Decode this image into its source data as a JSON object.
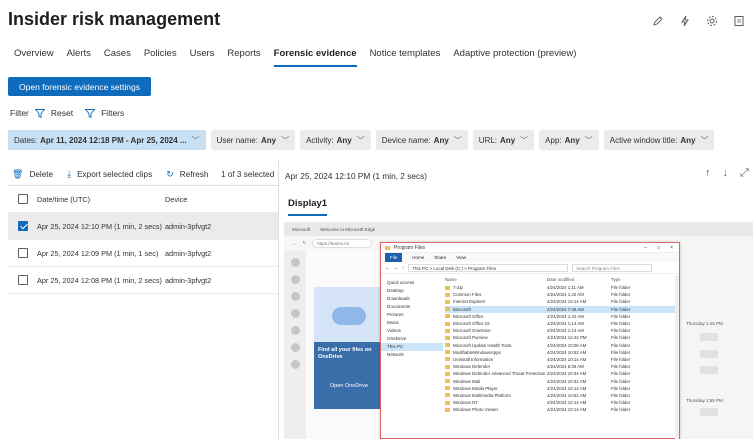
{
  "page": {
    "title": "Insider risk management"
  },
  "top_icons": [
    "edit-icon",
    "flash-icon",
    "settings-icon",
    "notepad-icon"
  ],
  "tabs": [
    {
      "label": "Overview",
      "active": false
    },
    {
      "label": "Alerts",
      "active": false
    },
    {
      "label": "Cases",
      "active": false
    },
    {
      "label": "Policies",
      "active": false
    },
    {
      "label": "Users",
      "active": false
    },
    {
      "label": "Reports",
      "active": false
    },
    {
      "label": "Forensic evidence",
      "active": true
    },
    {
      "label": "Notice templates",
      "active": false
    },
    {
      "label": "Adaptive protection (preview)",
      "active": false
    }
  ],
  "primary_button": "Open forensic evidence settings",
  "filter": {
    "label": "Filter",
    "reset": "Reset",
    "filters": "Filters"
  },
  "chips": [
    {
      "label": "Dates:",
      "value": "Apr 11, 2024 12:18 PM - Apr 25, 2024 ...",
      "selected": true
    },
    {
      "label": "User name:",
      "value": "Any",
      "selected": false
    },
    {
      "label": "Activity:",
      "value": "Any",
      "selected": false
    },
    {
      "label": "Device name:",
      "value": "Any",
      "selected": false
    },
    {
      "label": "URL:",
      "value": "Any",
      "selected": false
    },
    {
      "label": "App:",
      "value": "Any",
      "selected": false
    },
    {
      "label": "Active window title:",
      "value": "Any",
      "selected": false
    }
  ],
  "toolbar": {
    "delete": "Delete",
    "export": "Export selected clips",
    "refresh": "Refresh",
    "selection": "1 of 3 selected"
  },
  "table": {
    "headers": {
      "date": "Date/time (UTC)",
      "device": "Device"
    },
    "rows": [
      {
        "date": "Apr 25, 2024 12:10 PM (1 min, 2 secs)",
        "device": "admin-3pfvgt2",
        "checked": true
      },
      {
        "date": "Apr 25, 2024 12:09 PM (1 min, 1 sec)",
        "device": "admin-3pfvgt2",
        "checked": false
      },
      {
        "date": "Apr 25, 2024 12:08 PM (1 min, 2 secs)",
        "device": "admin-3pfvgt2",
        "checked": false
      }
    ]
  },
  "detail": {
    "title": "Apr 25, 2024 12:10 PM (1 min, 2 secs)",
    "display_tab": "Display1"
  },
  "recording": {
    "browser_tabs": [
      "Microsoft",
      "Welcome to Microsoft Edge"
    ],
    "browser_url": "https://teams.mi",
    "promo_text": "Find all your files on OneDrive",
    "promo_button": "Open OneDrive",
    "explorer": {
      "title": "Program Files",
      "ribbon": [
        "File",
        "Home",
        "Share",
        "View"
      ],
      "path": "This PC > Local Disk (C:) > Program Files",
      "search": "Search Program Files",
      "nav": [
        {
          "label": "Quick access",
          "hl": false
        },
        {
          "label": "Desktop",
          "hl": false
        },
        {
          "label": "Downloads",
          "hl": false
        },
        {
          "label": "Documents",
          "hl": false
        },
        {
          "label": "Pictures",
          "hl": false
        },
        {
          "label": "Music",
          "hl": false
        },
        {
          "label": "Videos",
          "hl": false
        },
        {
          "label": "OneDrive",
          "hl": false
        },
        {
          "label": "This PC",
          "hl": true
        },
        {
          "label": "Network",
          "hl": false
        }
      ],
      "columns": {
        "name": "Name",
        "date": "Date modified",
        "type": "Type"
      },
      "files": [
        {
          "name": "7-Zip",
          "date": "4/24/2024 1:11 AM",
          "type": "File folder",
          "hl": false
        },
        {
          "name": "Common Files",
          "date": "4/24/2024 1:42 AM",
          "type": "File folder",
          "hl": false
        },
        {
          "name": "Internet Explorer",
          "date": "4/24/2024 10:14 AM",
          "type": "File folder",
          "hl": false
        },
        {
          "name": "Microsoft",
          "date": "4/24/2024 7:49 AM",
          "type": "File folder",
          "hl": true
        },
        {
          "name": "Microsoft Office",
          "date": "4/24/2024 1:42 AM",
          "type": "File folder",
          "hl": false
        },
        {
          "name": "Microsoft Office 15",
          "date": "4/24/2024 1:14 AM",
          "type": "File folder",
          "hl": false
        },
        {
          "name": "Microsoft OneDrive",
          "date": "4/24/2024 1:14 AM",
          "type": "File folder",
          "hl": false
        },
        {
          "name": "Microsoft Purview",
          "date": "4/24/2024 12:42 PM",
          "type": "File folder",
          "hl": false
        },
        {
          "name": "Microsoft Update Health Tools",
          "date": "4/24/2024 10:06 AM",
          "type": "File folder",
          "hl": false
        },
        {
          "name": "ModifiableWindowsApps",
          "date": "4/24/2024 10:52 AM",
          "type": "File folder",
          "hl": false
        },
        {
          "name": "Uninstall Information",
          "date": "4/24/2024 10:14 AM",
          "type": "File folder",
          "hl": false
        },
        {
          "name": "Windows Defender",
          "date": "4/24/2024 6:39 AM",
          "type": "File folder",
          "hl": false
        },
        {
          "name": "Windows Defender Advanced Threat Protection",
          "date": "4/24/2024 10:34 AM",
          "type": "File folder",
          "hl": false
        },
        {
          "name": "Windows Mail",
          "date": "4/24/2024 10:32 AM",
          "type": "File folder",
          "hl": false
        },
        {
          "name": "Windows Media Player",
          "date": "4/24/2024 10:14 AM",
          "type": "File folder",
          "hl": false
        },
        {
          "name": "Windows Multimedia Platform",
          "date": "4/24/2024 10:52 AM",
          "type": "File folder",
          "hl": false
        },
        {
          "name": "Windows NT",
          "date": "4/24/2024 10:14 AM",
          "type": "File folder",
          "hl": false
        },
        {
          "name": "Windows Photo Viewer",
          "date": "4/24/2024 10:14 AM",
          "type": "File folder",
          "hl": false
        }
      ]
    },
    "side_labels": [
      "Thursday 1:45 PM",
      "Thursday 1:55 PM"
    ]
  }
}
